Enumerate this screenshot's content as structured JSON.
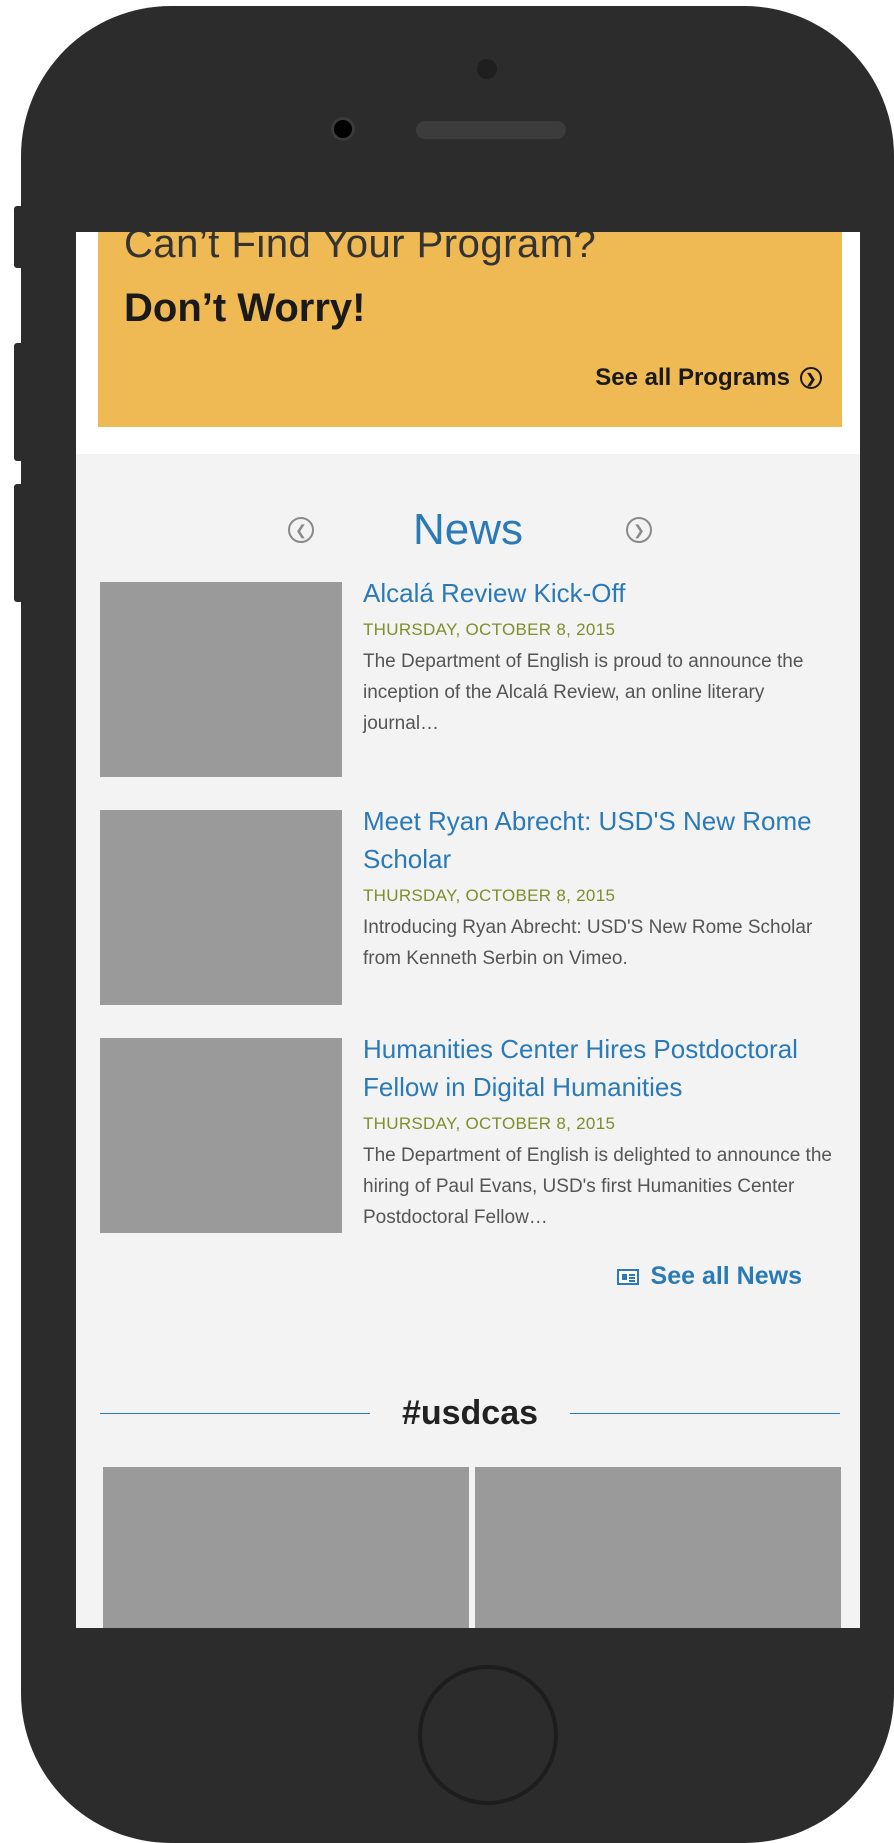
{
  "cta": {
    "heading": "Can’t Find Your Program?",
    "subheading": "Don’t Worry!",
    "link_label": "See all Programs",
    "link_icon": "circle-arrow-right-icon"
  },
  "news": {
    "title": "News",
    "prev_icon": "circle-arrow-left-icon",
    "next_icon": "circle-arrow-right-icon",
    "items": [
      {
        "headline": "Alcalá Review Kick-Off",
        "date": "THURSDAY, OCTOBER 8, 2015",
        "excerpt": "The Department of English is proud to announce the inception of the Alcalá Review, an online literary journal…"
      },
      {
        "headline": "Meet Ryan Abrecht: USD'S New Rome Scholar",
        "date": "THURSDAY, OCTOBER 8, 2015",
        "excerpt": "Introducing Ryan Abrecht: USD'S New Rome Scholar from Kenneth Serbin on Vimeo."
      },
      {
        "headline": "Humanities Center Hires Postdoctoral Fellow in Digital Humanities",
        "date": "THURSDAY, OCTOBER 8, 2015",
        "excerpt": "The Department of English is delighted to announce the hiring of Paul Evans, USD's first Humanities Center Postdoctoral Fellow…"
      }
    ],
    "see_all_label": "See all News",
    "see_all_icon": "newspaper-icon"
  },
  "social": {
    "hashtag": "#usdcas"
  },
  "colors": {
    "accent_blue": "#2a7ab8",
    "cta_gold": "#efb954",
    "date_green": "#7d8f2a",
    "phone_body": "#2b2c2b",
    "placeholder_gray": "#9a9a9a"
  }
}
